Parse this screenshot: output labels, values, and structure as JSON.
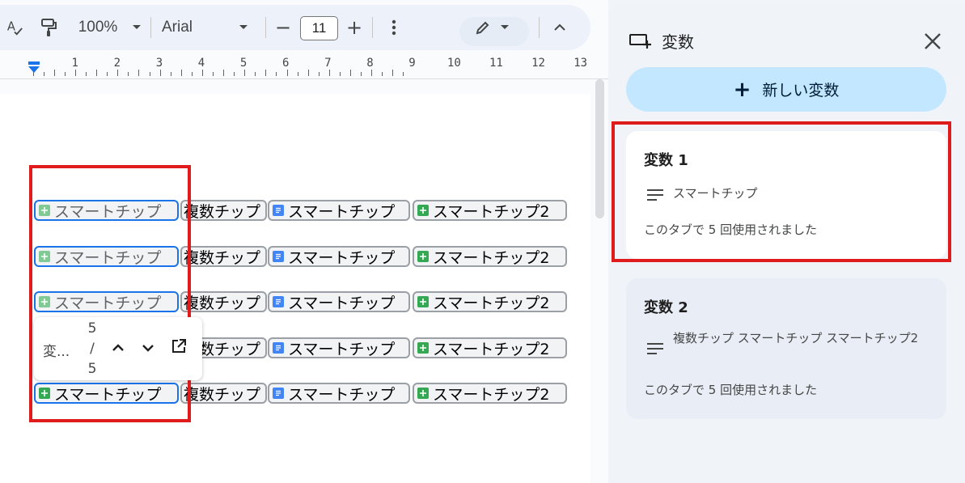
{
  "toolbar": {
    "zoom": "100%",
    "font_name": "Arial",
    "font_size": "11",
    "minus": "−",
    "plus": "+"
  },
  "ruler": {
    "numbers": [
      "1",
      "2",
      "3",
      "4",
      "5",
      "6",
      "7",
      "8",
      "9",
      "10",
      "11",
      "12",
      "13"
    ]
  },
  "document": {
    "rows": [
      {
        "var_chip": "スマートチップ",
        "plain": "複数チップ",
        "doc_chip": "スマートチップ",
        "sheet_chip": "スマートチップ2"
      },
      {
        "var_chip": "スマートチップ",
        "plain": "複数チップ",
        "doc_chip": "スマートチップ",
        "sheet_chip": "スマートチップ2"
      },
      {
        "var_chip": "スマートチップ",
        "plain": "複数チップ",
        "doc_chip": "スマートチップ",
        "sheet_chip": "スマートチップ2"
      },
      {
        "var_chip": "",
        "plain": "複数チップ",
        "doc_chip": "スマートチップ",
        "sheet_chip": "スマートチップ2"
      },
      {
        "var_chip": "スマートチップ",
        "plain": "複数チップ",
        "doc_chip": "スマートチップ",
        "sheet_chip": "スマートチップ2"
      }
    ]
  },
  "popup": {
    "label": "変...",
    "count_current": "5",
    "count_sep": "/",
    "count_total": "5"
  },
  "panel": {
    "title": "変数",
    "new_variable_label": "新しい変数",
    "variables": [
      {
        "name": "変数 1",
        "value": "スマートチップ",
        "usage": "このタブで 5 回使用されました"
      },
      {
        "name": "変数 2",
        "value": "複数チップ スマートチップ スマートチップ2",
        "usage": "このタブで 5 回使用されました"
      }
    ]
  },
  "colors": {
    "highlight_box": "#e01b1b",
    "variable_chip_border": "#1a73e8",
    "new_variable_button": "#c2e7ff",
    "sheet_icon": "#34a853",
    "doc_icon": "#4285f4"
  }
}
